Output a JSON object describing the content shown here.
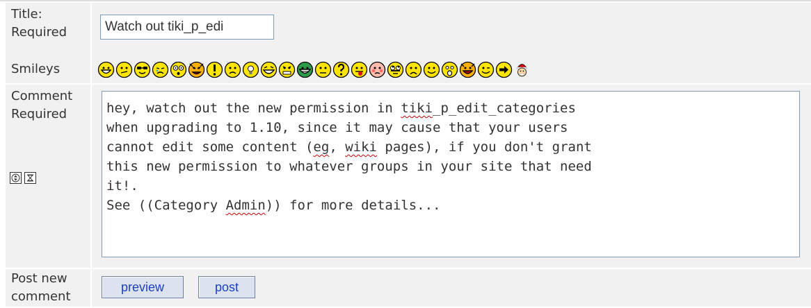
{
  "form": {
    "title_row": {
      "label": "Title:\nRequired",
      "value": "Watch out tiki_p_edi"
    },
    "smileys_row": {
      "label": "Smileys",
      "smileys": [
        "biggrin-smiley-icon",
        "confused-smiley-icon",
        "cool-smiley-icon",
        "cry-smiley-icon",
        "eek-smiley-icon",
        "evil-smiley-icon",
        "exclaim-smiley-icon",
        "frown-smiley-icon",
        "idea-smiley-icon",
        "lol-smiley-icon",
        "mad-smiley-icon",
        "mrgreen-smiley-icon",
        "neutral-smiley-icon",
        "question-smiley-icon",
        "razz-smiley-icon",
        "redface-smiley-icon",
        "rolleyes-smiley-icon",
        "sad-smiley-icon",
        "smile-smiley-icon",
        "surprised-smiley-icon",
        "twisted-smiley-icon",
        "wink-smiley-icon",
        "arrow-smiley-icon",
        "santa-smiley-icon"
      ]
    },
    "comment_row": {
      "label": "Comment\nRequired",
      "body_lines": [
        "hey, watch out the new permission in tiki_p_edit_categories",
        "when upgrading to 1.10, since it may cause that your users",
        "cannot edit some content (eg, wiki pages), if you don't grant",
        "this new permission to whatever groups in your site that need",
        "it!.",
        "See ((Category Admin)) for more details..."
      ],
      "tools": [
        "resize-textarea-icon",
        "hourglass-icon"
      ]
    },
    "post_row": {
      "label": "Post new\ncomment",
      "preview_label": "preview",
      "post_label": "post"
    }
  },
  "colors": {
    "cell_bg": "#f1f1f1",
    "button_text": "#1a3fc4",
    "button_bg": "#dde3ee",
    "input_border": "#7f9db9",
    "smiley_yellow": "#ffe500"
  }
}
